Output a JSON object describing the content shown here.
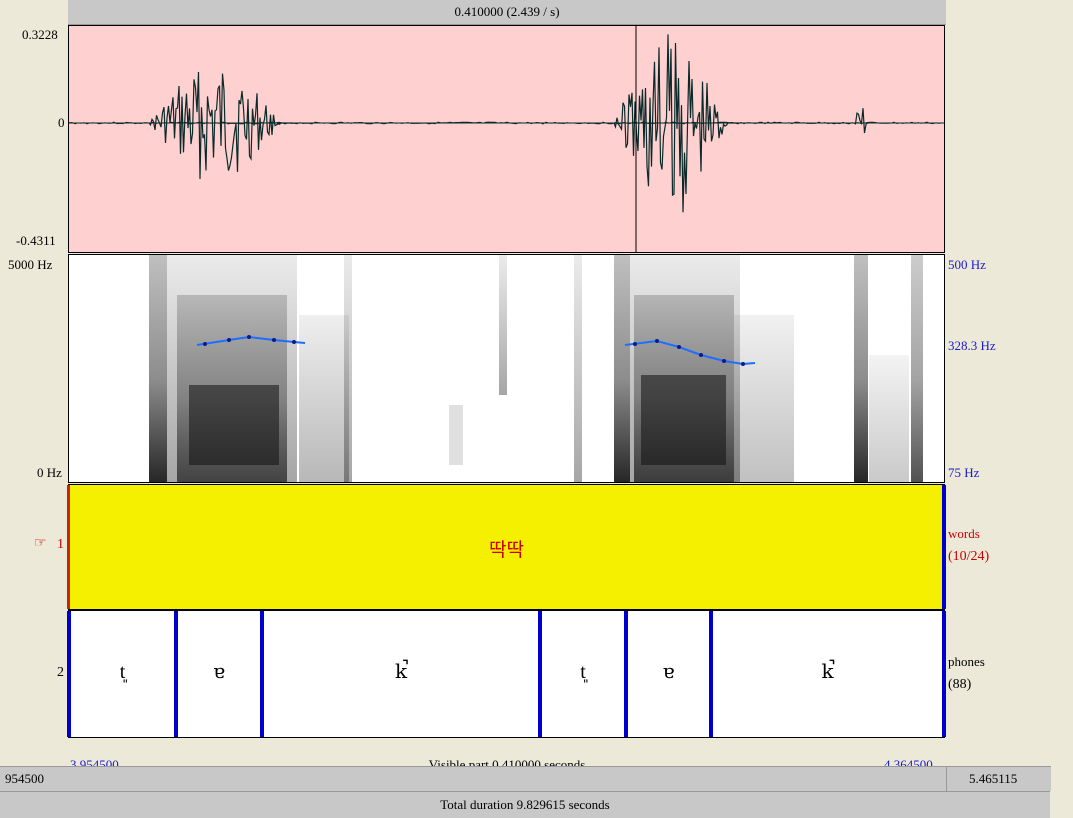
{
  "top_bar": {
    "selection_label": "0.410000 (2.439 / s)"
  },
  "waveform": {
    "y_max": "0.3228",
    "y_zero": "0",
    "y_min": "-0.4311"
  },
  "spectrogram": {
    "freq_top": "5000 Hz",
    "freq_bottom": "0 Hz",
    "pitch_top": "500 Hz",
    "pitch_mid": "328.3 Hz",
    "pitch_bottom": "75 Hz"
  },
  "tiers": {
    "tier1": {
      "number": "1",
      "name": "words",
      "count": "(10/24)",
      "text": "딱딱",
      "pointer_icon": "hand-pointer-icon"
    },
    "tier2": {
      "number": "2",
      "name": "phones",
      "count": "(88)",
      "phones": [
        "t͈",
        "ɐ",
        "k̚",
        "t͈",
        "ɐ",
        "k̚"
      ]
    }
  },
  "time": {
    "left_visible": "3.954500",
    "right_visible": "4.364500",
    "visible_part": "Visible part 0.410000 seconds",
    "left_total": "954500",
    "right_total": "5.465115",
    "total_duration": "Total duration 9.829615 seconds"
  },
  "colors": {
    "waveform_bg": "#ffd0d0",
    "tier_selected": "#f5ef00",
    "boundary": "#0000cc",
    "pitch": "#1e6fff"
  }
}
